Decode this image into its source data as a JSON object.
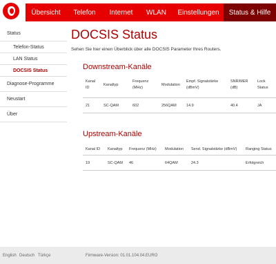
{
  "nav": {
    "items": [
      "Übersicht",
      "Telefon",
      "Internet",
      "WLAN",
      "Einstellungen",
      "Status & Hilfe"
    ]
  },
  "sidebar": {
    "items": [
      "Status",
      "Telefon-Status",
      "LAN Status",
      "DOCSIS Status",
      "Diagnose-Programme",
      "Neustart",
      "Über"
    ]
  },
  "main": {
    "title": "DOCSIS Status",
    "description": "Sehen Sie hier einen Überblick über alle DOCSIS Parameter Ihres Routers."
  },
  "downstream": {
    "title": "Downstream-Kanäle",
    "headers": [
      [
        "Kanal",
        "ID"
      ],
      [
        "Kanaltyp"
      ],
      [
        "Frequenz",
        "(MHz)"
      ],
      [
        "Modulation"
      ],
      [
        "Empf. Signalstärke",
        "(dBmV)"
      ],
      [
        "SNR/MER",
        "(dB)"
      ],
      [
        "Lock",
        "Status"
      ]
    ],
    "rows": [
      [
        "21",
        "SC-QAM",
        "602",
        "256QAM",
        "14.9",
        "40.4",
        "JA"
      ]
    ]
  },
  "upstream": {
    "title": "Upstream-Kanäle",
    "headers": [
      "Kanal ID",
      "Kanaltyp",
      "Frequenz (MHz)",
      "Modulation",
      "Send. Signalstärke (dBmV)",
      "Ranging Status"
    ],
    "rows": [
      [
        "19",
        "SC-QAM",
        "46",
        "64QAM",
        "24.3",
        "Erfolgreich"
      ]
    ]
  },
  "footer": {
    "languages": [
      "English",
      "Deutsch",
      "Türkçe"
    ],
    "firmware": "Firmware-Version: 01.01.104.04.EURO"
  },
  "colors": {
    "brand_red": "#e60000",
    "active_nav": "#7d0000",
    "accent_text": "#b00000"
  }
}
